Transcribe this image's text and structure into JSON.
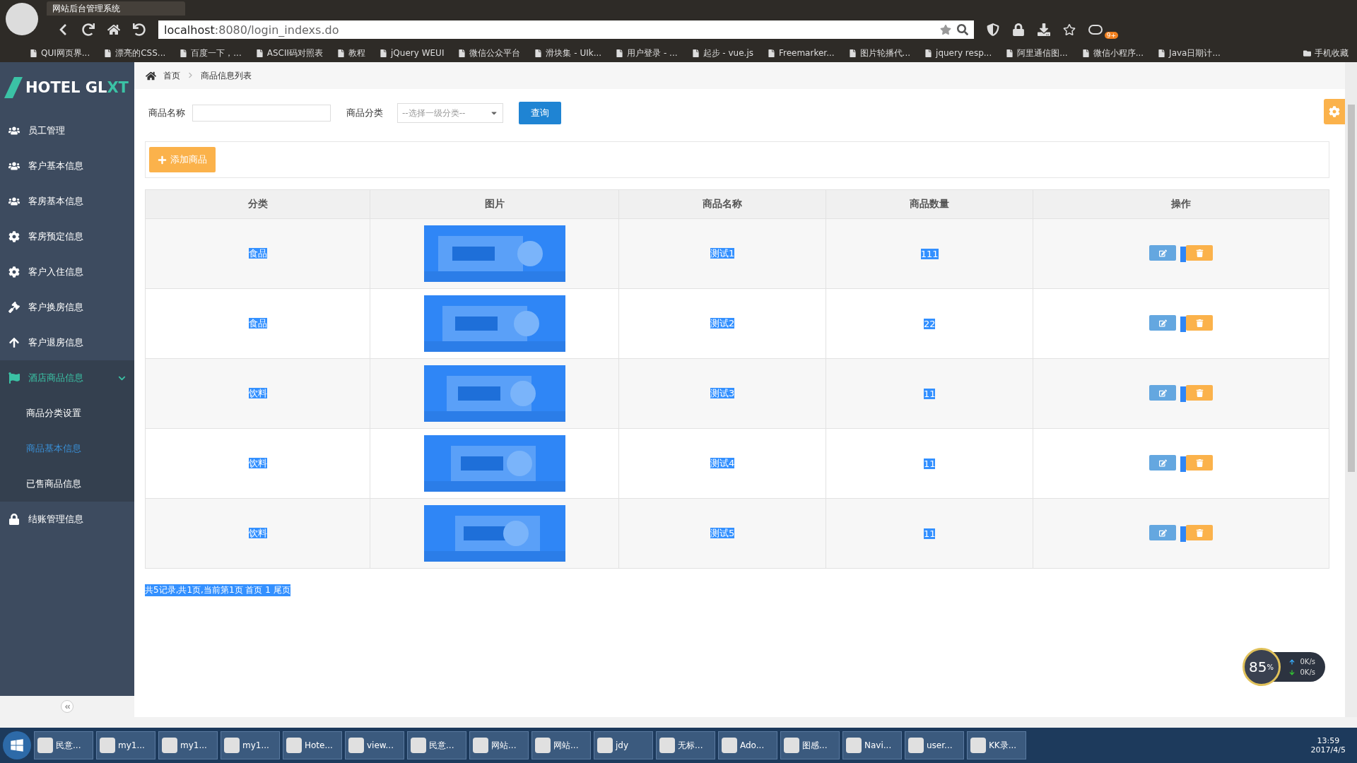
{
  "browser": {
    "tab_title": "网站后台管理系统",
    "url_host": "localhost",
    "url_rest": ":8080/login_indexs.do",
    "badge": "9+",
    "bookmarks": [
      "QUI网页界...",
      "漂亮的CSS...",
      "百度一下，...",
      "ASCII码对照表",
      "教程",
      "jQuery WEUI",
      "微信公众平台",
      "滑块集 - UIk...",
      "用户登录 - ...",
      "起步 - vue.js",
      "Freemarker...",
      "图片轮播代...",
      "jquery resp...",
      "阿里通信图...",
      "微信小程序...",
      "Java日期计..."
    ],
    "mobile_bookmarks": "手机收藏"
  },
  "sidebar": {
    "logo_main": "HOTEL GL",
    "logo_accent": "XT",
    "items": [
      {
        "label": "员工管理",
        "expanded": false
      },
      {
        "label": "客户基本信息",
        "expanded": false
      },
      {
        "label": "客房基本信息",
        "expanded": false
      },
      {
        "label": "客房预定信息",
        "expanded": false
      },
      {
        "label": "客户入住信息",
        "expanded": false
      },
      {
        "label": "客户换房信息",
        "expanded": false
      },
      {
        "label": "客户退房信息",
        "expanded": false
      },
      {
        "label": "酒店商品信息",
        "expanded": true,
        "children": [
          {
            "label": "商品分类设置",
            "selected": false
          },
          {
            "label": "商品基本信息",
            "selected": true
          },
          {
            "label": "已售商品信息",
            "selected": false
          }
        ]
      },
      {
        "label": "结账管理信息",
        "expanded": false
      }
    ]
  },
  "breadcrumb": [
    "首页",
    "商品信息列表"
  ],
  "search": {
    "name_label": "商品名称",
    "category_label": "商品分类",
    "category_value": "--选择一级分类--",
    "button": "查询"
  },
  "add_button": "添加商品",
  "text_selection": true,
  "table": {
    "columns": [
      "分类",
      "图片",
      "商品名称",
      "商品数量",
      "操作"
    ],
    "rows": [
      {
        "category": "食品",
        "name": "测试1",
        "quantity": "111"
      },
      {
        "category": "食品",
        "name": "测试2",
        "quantity": "22"
      },
      {
        "category": "饮料",
        "name": "测试3",
        "quantity": "11"
      },
      {
        "category": "饮料",
        "name": "测试4",
        "quantity": "11"
      },
      {
        "category": "饮料",
        "name": "测试5",
        "quantity": "11"
      }
    ]
  },
  "pager": "共5记录,共1页,当前第1页 首页 1 尾页",
  "net_widget": {
    "percent": "85",
    "unit": "%",
    "up": "0K/s",
    "down": "0K/s"
  },
  "taskbar": {
    "items": [
      "民意...",
      "my1...",
      "my1...",
      "my1...",
      "Hote...",
      "view...",
      "民意...",
      "网站...",
      "网站...",
      "jdy",
      "无标...",
      "Ado...",
      "图感...",
      "Navi...",
      "user...",
      "KK录..."
    ],
    "time": "13:59",
    "date": "2017/4/5"
  }
}
